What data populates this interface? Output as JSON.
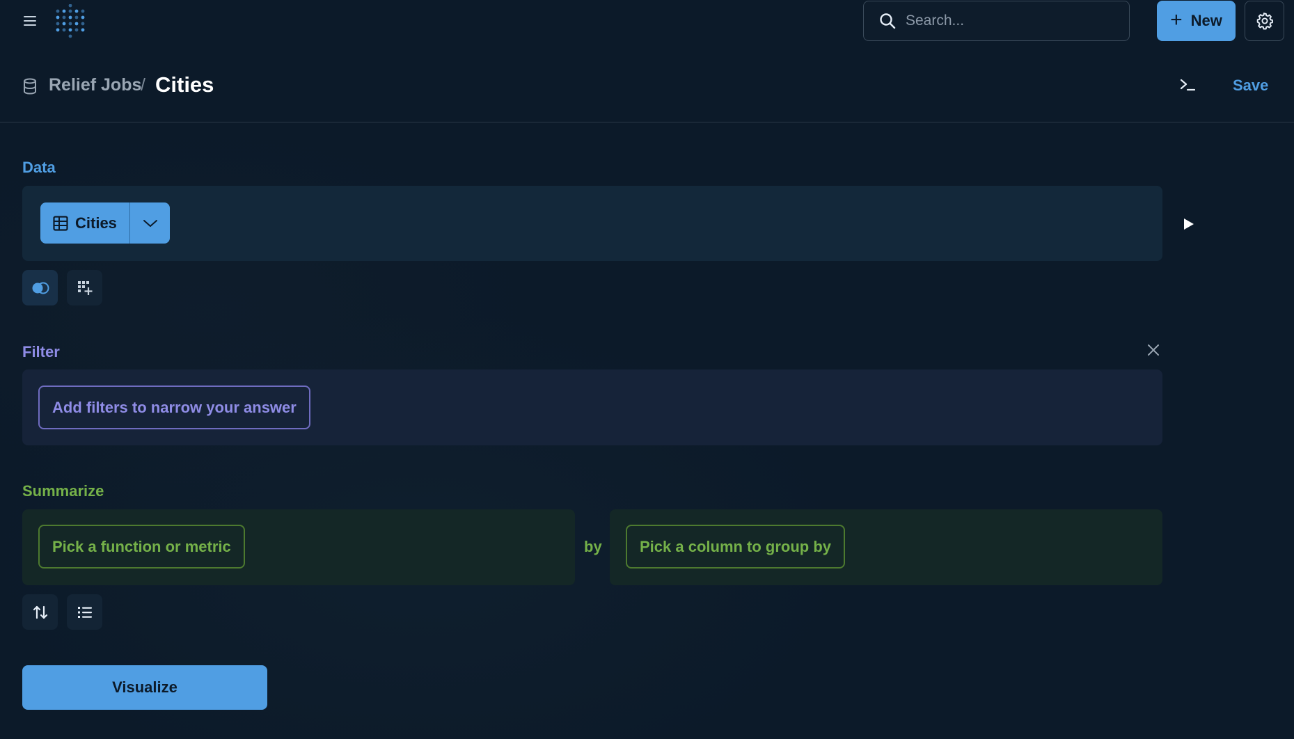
{
  "topbar": {
    "search_placeholder": "Search...",
    "new_label": "New",
    "icons": [
      "menu-icon",
      "metabase-logo",
      "search-icon",
      "plus-icon",
      "gear-icon"
    ]
  },
  "header": {
    "breadcrumb_parent": "Relief Jobs",
    "breadcrumb_separator": "/",
    "title": "Cities",
    "save_label": "Save",
    "icons": [
      "database-icon",
      "terminal-icon"
    ]
  },
  "data_section": {
    "label": "Data",
    "table_name": "Cities",
    "icons": [
      "table-icon",
      "chevron-down-icon",
      "play-icon",
      "join-icon",
      "add-column-icon"
    ]
  },
  "filter_section": {
    "label": "Filter",
    "button_label": "Add filters to narrow your answer",
    "icons": [
      "close-icon"
    ]
  },
  "summarize_section": {
    "label": "Summarize",
    "metric_button_label": "Pick a function or metric",
    "by_label": "by",
    "group_button_label": "Pick a column to group by",
    "icons": [
      "sort-icon",
      "limit-icon"
    ]
  },
  "visualize_label": "Visualize",
  "colors": {
    "background": "#0c1a29",
    "brand": "#509ee3",
    "filter": "#8f8ce6",
    "summarize": "#75b149"
  }
}
